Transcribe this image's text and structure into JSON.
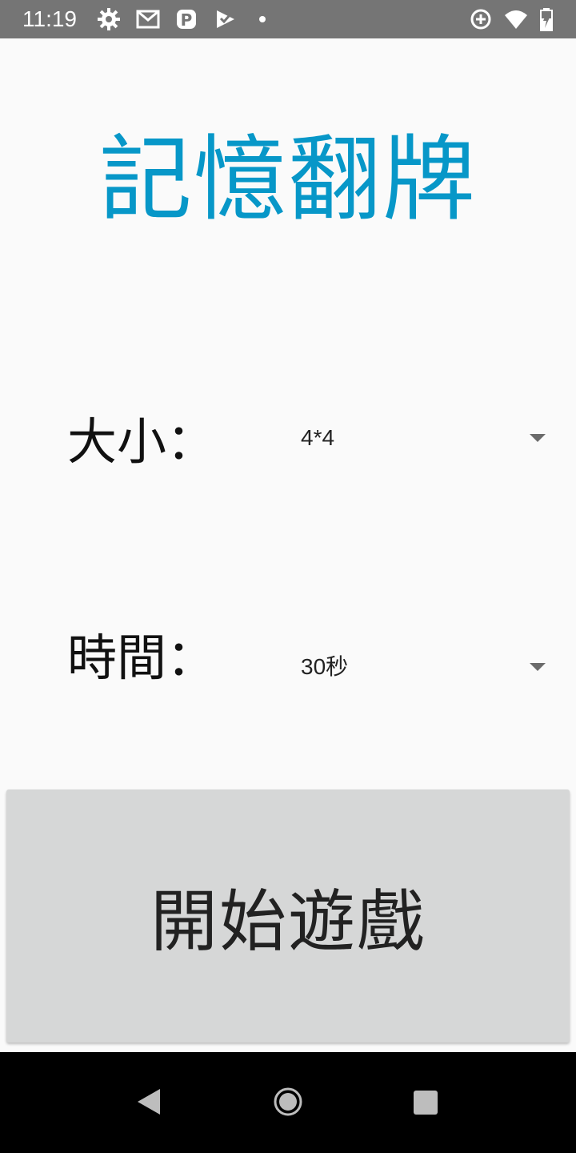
{
  "status_bar": {
    "time": "11:19",
    "left_icons": [
      "settings-icon",
      "gmail-icon",
      "p-app-icon",
      "check-app-icon",
      "dot-icon"
    ],
    "right_icons": [
      "data-saver-icon",
      "wifi-icon",
      "battery-charging-icon"
    ]
  },
  "app": {
    "title": "記憶翻牌"
  },
  "form": {
    "size_label": "大小：",
    "size_value": "4*4",
    "time_label": "時間：",
    "time_value": "30秒"
  },
  "start_button": {
    "label": "開始遊戲"
  },
  "nav_bar": {
    "buttons": [
      "back-icon",
      "home-icon",
      "recents-icon"
    ]
  },
  "colors": {
    "title": "#0797c8",
    "button_bg": "#d6d7d7",
    "status_bar_bg": "#757575"
  }
}
